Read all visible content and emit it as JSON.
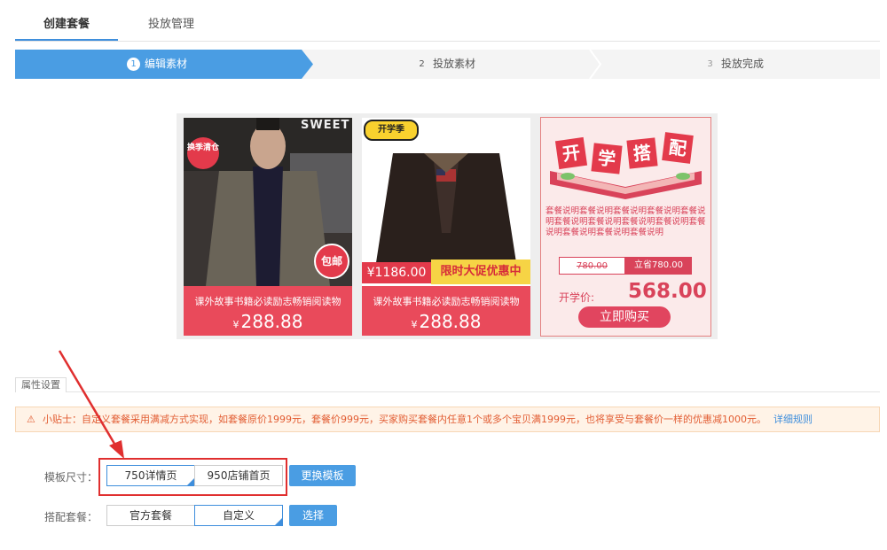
{
  "tabs": [
    {
      "label": "创建套餐",
      "active": true
    },
    {
      "label": "投放管理",
      "active": false
    }
  ],
  "steps": [
    {
      "num": "1",
      "label": "编辑素材",
      "active": true
    },
    {
      "num": "2",
      "label": "投放素材",
      "active": false
    },
    {
      "num": "3",
      "label": "投放完成",
      "active": false
    }
  ],
  "preview": {
    "cards": [
      {
        "badge": "换季清仓",
        "stamp": "包邮",
        "title": "课外故事书籍必读励志畅销阅读物",
        "currency": "¥",
        "price": "288.88"
      },
      {
        "badge": "开学季",
        "banner_price": "¥1186.00",
        "banner_label": "限时大促优惠中",
        "poster_text": "SWEET",
        "title": "课外故事书籍必读励志畅销阅读物",
        "currency": "¥",
        "price": "288.88"
      }
    ],
    "promo": {
      "headline": [
        "开",
        "学",
        "搭",
        "配"
      ],
      "description": "套餐说明套餐说明套餐说明套餐说明套餐说明套餐说明套餐说明套餐说明套餐说明套餐说明套餐说明套餐说明套餐说明",
      "original_price": "780.00",
      "save_label": "立省780.00",
      "sale_label": "开学价:",
      "sale_price": "568.00",
      "buy_label": "立即购买"
    }
  },
  "section": {
    "title": "属性设置"
  },
  "tip": {
    "icon": "warning-icon",
    "text": "小贴士：自定义套餐采用满减方式实现，如套餐原价1999元，套餐价999元，买家购买套餐内任意1个或多个宝贝满1999元，也将享受与套餐价一样的优惠减1000元。",
    "link": "详细规则"
  },
  "template_size": {
    "label": "模板尺寸：",
    "options": [
      {
        "label": "750详情页",
        "selected": true
      },
      {
        "label": "950店铺首页",
        "selected": false
      }
    ],
    "button": "更换模板"
  },
  "combo": {
    "label": "搭配套餐：",
    "options": [
      {
        "label": "官方套餐",
        "selected": false
      },
      {
        "label": "自定义",
        "selected": true
      }
    ],
    "button": "选择"
  },
  "colors": {
    "accent": "#3e8edc",
    "step_active": "#4a9de3",
    "card_red": "#e94a5b",
    "annotation_red": "#e02f2f"
  }
}
